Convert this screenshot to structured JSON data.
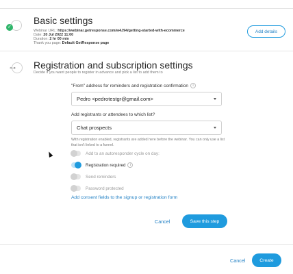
{
  "basic_settings": {
    "title": "Basic settings",
    "webinar_url_label": "Webinar URL:",
    "webinar_url": "https://webinar.getresponse.com/w4J94/getting-started-with-ecommerce",
    "date_label": "Date:",
    "date": "20 Jul 2022 11:00",
    "duration_label": "Duration:",
    "duration": "2 hr 00 min",
    "thank_you_label": "Thank you page:",
    "thank_you_page": "Default GetResponse page",
    "add_details_label": "Add details"
  },
  "registration": {
    "title": "Registration and subscription settings",
    "subtitle": "Decide if you want people to register in advance and pick a list to add them to",
    "from_label": "\"From\" address for reminders and registration confirmation",
    "from_value": "Pedro <pedrotestgr@gmail.com>",
    "list_label": "Add registrants or attendees to which list?",
    "list_value": "Chat prospects",
    "help_text": "With registration enabled, registrants are added here before the webinar. You can only use a list that isn't linked to a funnel.",
    "toggles": [
      {
        "label": "Add to an autoresponder cycle on day:",
        "on": false
      },
      {
        "label": "Registration required",
        "on": true
      },
      {
        "label": "Send reminders",
        "on": false
      },
      {
        "label": "Password protected",
        "on": false
      }
    ],
    "consent_link": "Add consent fields to the signup or registration form",
    "cancel_label": "Cancel",
    "save_label": "Save this step"
  },
  "footer": {
    "cancel_label": "Cancel",
    "create_label": "Create"
  },
  "colors": {
    "accent": "#1f9bde",
    "link": "#1f7fc4",
    "success": "#2fb56a"
  },
  "icons": {
    "step1": "check-circle-icon",
    "step2": "key-icon",
    "info": "info-icon",
    "caret": "chevron-down-icon"
  }
}
